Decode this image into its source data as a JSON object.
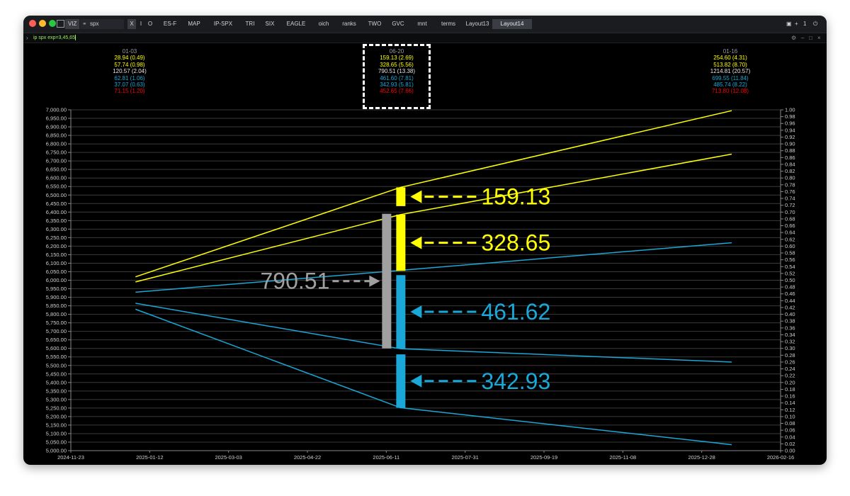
{
  "toolbar": {
    "viz_label": "VIZ",
    "symbol_value": "spx",
    "x_label": "X",
    "i_label": "I",
    "o_label": "O",
    "tabs": [
      {
        "label": "ES-F"
      },
      {
        "label": "MAP"
      },
      {
        "label": "IP-SPX"
      },
      {
        "label": "TRI"
      },
      {
        "label": "SIX"
      },
      {
        "label": "EAGLE"
      },
      {
        "label": "oich"
      },
      {
        "label": "ranks"
      },
      {
        "label": "TWO"
      },
      {
        "label": "GVC"
      },
      {
        "label": "mnt"
      },
      {
        "label": "terms"
      },
      {
        "label": "Layout13"
      },
      {
        "label": "Layout14"
      }
    ],
    "active_tab": "Layout14",
    "right_plus": "+",
    "right_count": "1"
  },
  "command": {
    "text": "ip spx exp=3,45,65"
  },
  "colors": {
    "yellow": "#ffff00",
    "cyan": "#19a8d8",
    "gray": "#a0a0a0",
    "red": "#ff0000",
    "white": "#e6e6e6",
    "grid": "#3a3a3a"
  },
  "chart_data": {
    "type": "line",
    "left_axis": {
      "min": 5000,
      "max": 7000,
      "step": 50,
      "tick_labels": [
        "5,000.00",
        "5,050.00",
        "5,100.00",
        "5,150.00",
        "5,200.00",
        "5,250.00",
        "5,300.00",
        "5,350.00",
        "5,400.00",
        "5,450.00",
        "5,500.00",
        "5,550.00",
        "5,600.00",
        "5,650.00",
        "5,700.00",
        "5,750.00",
        "5,800.00",
        "5,850.00",
        "5,900.00",
        "5,950.00",
        "6,000.00",
        "6,050.00",
        "6,100.00",
        "6,150.00",
        "6,200.00",
        "6,250.00",
        "6,300.00",
        "6,350.00",
        "6,400.00",
        "6,450.00",
        "6,500.00",
        "6,550.00",
        "6,600.00",
        "6,650.00",
        "6,700.00",
        "6,750.00",
        "6,800.00",
        "6,850.00",
        "6,900.00",
        "6,950.00",
        "7,000.00"
      ]
    },
    "right_axis": {
      "min": 0,
      "max": 1,
      "step": 0.02,
      "tick_labels": [
        "0.00",
        "0.02",
        "0.04",
        "0.06",
        "0.08",
        "0.10",
        "0.12",
        "0.14",
        "0.16",
        "0.18",
        "0.20",
        "0.22",
        "0.24",
        "0.26",
        "0.28",
        "0.30",
        "0.32",
        "0.34",
        "0.36",
        "0.38",
        "0.40",
        "0.42",
        "0.44",
        "0.46",
        "0.48",
        "0.50",
        "0.52",
        "0.54",
        "0.56",
        "0.58",
        "0.60",
        "0.62",
        "0.64",
        "0.66",
        "0.68",
        "0.70",
        "0.72",
        "0.74",
        "0.76",
        "0.78",
        "0.80",
        "0.82",
        "0.84",
        "0.86",
        "0.88",
        "0.90",
        "0.92",
        "0.94",
        "0.96",
        "0.98",
        "1.00"
      ]
    },
    "x_axis": {
      "min": "2024-11-23",
      "max": "2026-02-16",
      "tick_labels": [
        "2024-11-23",
        "2025-01-12",
        "2025-03-03",
        "2025-04-22",
        "2025-06-11",
        "2025-07-31",
        "2025-09-19",
        "2025-11-08",
        "2025-12-28",
        "2026-02-16"
      ],
      "tick_dates": [
        "2024-11-23",
        "2025-01-12",
        "2025-03-03",
        "2025-04-22",
        "2025-06-11",
        "2025-07-31",
        "2025-09-19",
        "2025-11-08",
        "2025-12-28",
        "2026-02-16"
      ]
    },
    "series": [
      {
        "color": "yellow",
        "points": [
          {
            "x": "2025-01-03",
            "y": 6020
          },
          {
            "x": "2025-06-20",
            "y": 6545
          },
          {
            "x": "2026-01-16",
            "y": 6995
          }
        ]
      },
      {
        "color": "yellow",
        "points": [
          {
            "x": "2025-01-03",
            "y": 5990
          },
          {
            "x": "2025-06-20",
            "y": 6385
          },
          {
            "x": "2026-01-16",
            "y": 6740
          }
        ]
      },
      {
        "color": "cyan",
        "points": [
          {
            "x": "2025-01-03",
            "y": 5930
          },
          {
            "x": "2025-06-20",
            "y": 6058
          },
          {
            "x": "2026-01-16",
            "y": 6220
          }
        ]
      },
      {
        "color": "cyan",
        "points": [
          {
            "x": "2025-01-03",
            "y": 5865
          },
          {
            "x": "2025-06-20",
            "y": 5598
          },
          {
            "x": "2026-01-16",
            "y": 5520
          }
        ]
      },
      {
        "color": "cyan",
        "points": [
          {
            "x": "2025-01-03",
            "y": 5830
          },
          {
            "x": "2025-06-20",
            "y": 5252
          },
          {
            "x": "2026-01-16",
            "y": 5035
          }
        ]
      }
    ],
    "columns": [
      {
        "date": "01-03",
        "rows": [
          "28.94 (0.49)",
          "57.74 (0.98)",
          "120.57 (2.04)",
          "62.81 (1.06)",
          "37.07 (0.63)",
          "71.15 (1.20)"
        ]
      },
      {
        "date": "06-20",
        "rows": [
          "159.13 (2.69)",
          "328.65 (5.56)",
          "790.51 (13.38)",
          "461.60 (7.81)",
          "342.93 (5.81)",
          "452.65 (7.66)"
        ]
      },
      {
        "date": "01-16",
        "rows": [
          "254.60 (4.31)",
          "513.82 (8.70)",
          "1214.81 (20.57)",
          "699.55 (11.84)",
          "485.74 (8.22)",
          "713.80 (12.08)"
        ]
      }
    ],
    "row_colors": [
      "yellow",
      "yellow",
      "white",
      "cyan",
      "cyan",
      "red"
    ],
    "bars": [
      {
        "label": "159.13",
        "color": "yellow",
        "y_from": 6435,
        "y_to": 6545
      },
      {
        "label": "328.65",
        "color": "yellow",
        "y_from": 6055,
        "y_to": 6385
      },
      {
        "label": "790.51",
        "color": "gray",
        "y_from": 5600,
        "y_to": 6390
      },
      {
        "label": "461.62",
        "color": "cyan",
        "y_from": 5600,
        "y_to": 6030
      },
      {
        "label": "342.93",
        "color": "cyan",
        "y_from": 5252,
        "y_to": 5565
      }
    ]
  }
}
